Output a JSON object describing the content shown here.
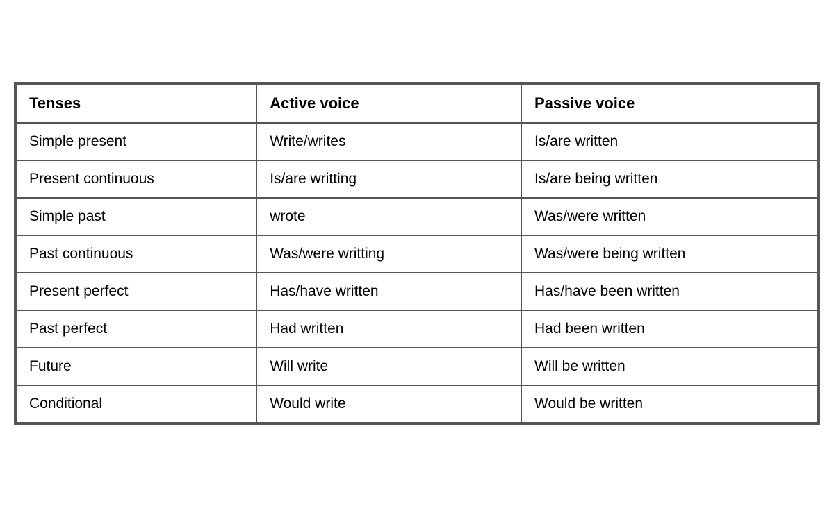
{
  "table": {
    "headers": {
      "tenses": "Tenses",
      "active": "Active voice",
      "passive": "Passive voice"
    },
    "rows": [
      {
        "tense": "Simple present",
        "active": "Write/writes",
        "passive": "Is/are written"
      },
      {
        "tense": "Present continuous",
        "active": "Is/are writting",
        "passive": "Is/are being written"
      },
      {
        "tense": "Simple past",
        "active": "wrote",
        "passive": "Was/were written"
      },
      {
        "tense": "Past continuous",
        "active": "Was/were writting",
        "passive": "Was/were being written"
      },
      {
        "tense": "Present perfect",
        "active": "Has/have written",
        "passive": "Has/have been written"
      },
      {
        "tense": "Past perfect",
        "active": "Had written",
        "passive": "Had been written"
      },
      {
        "tense": "Future",
        "active": "Will write",
        "passive": "Will be written"
      },
      {
        "tense": "Conditional",
        "active": "Would write",
        "passive": "Would be written"
      }
    ]
  }
}
